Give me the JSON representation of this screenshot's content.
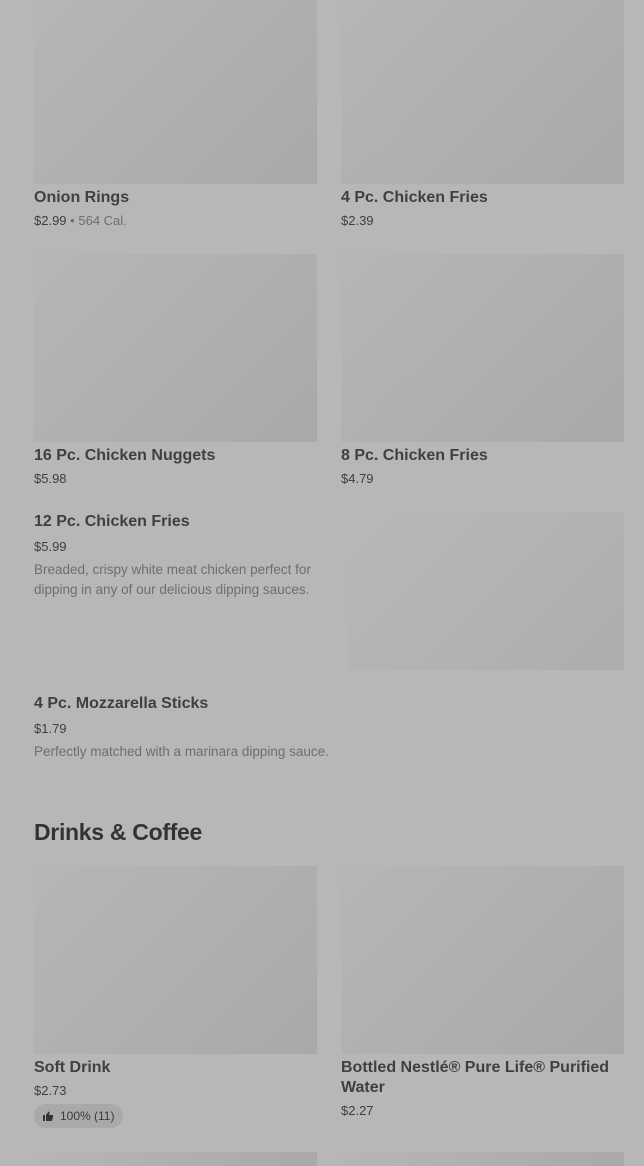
{
  "items": [
    {
      "name": "Onion Rings",
      "price": "$2.99",
      "separator": "•",
      "calories": "564 Cal."
    },
    {
      "name": "4 Pc. Chicken Fries",
      "price": "$2.39"
    },
    {
      "name": "16 Pc. Chicken Nuggets",
      "price": "$5.98"
    },
    {
      "name": "8 Pc. Chicken Fries",
      "price": "$4.79"
    },
    {
      "name": "12 Pc. Chicken Fries",
      "price": "$5.99",
      "description": "Breaded, crispy white meat chicken perfect for dipping in any of our delicious dipping sauces."
    },
    {
      "name": "4 Pc. Mozzarella Sticks",
      "price": "$1.79",
      "description": "Perfectly matched with a marinara dipping sauce."
    }
  ],
  "drinks_section": {
    "title": "Drinks & Coffee",
    "items": [
      {
        "name": "Soft Drink",
        "price": "$2.73",
        "rating": "100% (11)"
      },
      {
        "name": "Bottled Nestlé® Pure Life® Purified Water",
        "price": "$2.27"
      }
    ]
  },
  "icons": {
    "rating_icon": "thumbs-up-icon"
  }
}
